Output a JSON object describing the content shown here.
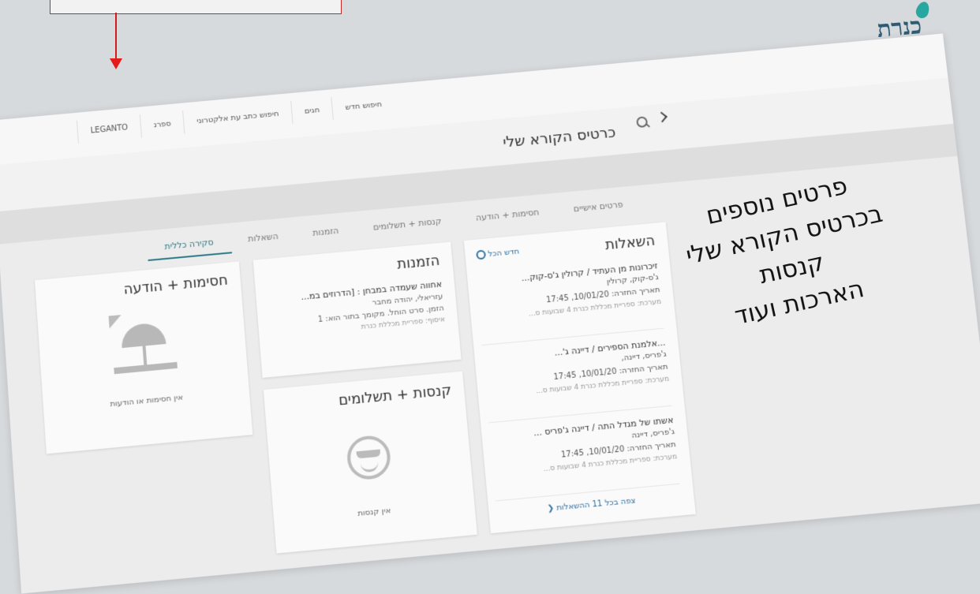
{
  "app": {
    "logo": "כנרת"
  },
  "nav": {
    "items": [
      "LEGANTO",
      "ספרנ",
      "חיפוש כתב עת אלקטרוני",
      "חגים",
      "חיפוש חדש"
    ]
  },
  "page": {
    "title": "כרטיס הקורא שלי"
  },
  "tabs": [
    "סקירה כללית",
    "השאלות",
    "הזמנות",
    "קנסות + תשלומים",
    "חסימות + הודעה",
    "פרטים אישיים"
  ],
  "loans": {
    "title": "השאלות",
    "view_all": "חדש הכל",
    "items": [
      {
        "title": "זיכרונות מן העתיד / קרולין ג'ס-קוק...",
        "author": "ג'ס-קוק, קרולין",
        "due": "תאריך החזרה: 10/01/20, 17:45",
        "location": "מערכת: ספריית מכללת כנרת 4 שבועות ס..."
      },
      {
        "title": "...אלמנת הספירים / דיינה ג'...",
        "author": "ג'פריס, דיינה,",
        "due": "תאריך החזרה: 10/01/20, 17:45",
        "location": "מערכת: ספריית מכללת כנרת 4 שבועות ס..."
      },
      {
        "title": "אשתו של מגדל התה / דיינה ג'פריס ...",
        "author": "ג'פריס, דיינה",
        "due": "תאריך החזרה: 10/01/20, 17:45",
        "location": "מערכת: ספריית מכללת כנרת 4 שבועות ס..."
      }
    ],
    "see_all": "צפה בכל 11 ההשאלות"
  },
  "holds": {
    "title": "הזמנות",
    "item": {
      "title": "אחווה שעמדה במבחן : [הדרוזים במ...",
      "author": "עזריאלי, יהודה מחבר",
      "status": "הזמן. סרט הוחל. מקומך בתור הוא: 1",
      "location": "איסוף: ספריית מכללת כנרת"
    }
  },
  "fines": {
    "title": "קנסות + תשלומים",
    "empty": "אין קנסות"
  },
  "blocks": {
    "title": "חסימות + הודעה",
    "empty": "אין חסימות או הודעות"
  },
  "overlay": {
    "lines": [
      "פרטים נוספים",
      "בכרטיס הקורא שלי",
      "קנסות",
      "הארכות ועוד"
    ]
  }
}
